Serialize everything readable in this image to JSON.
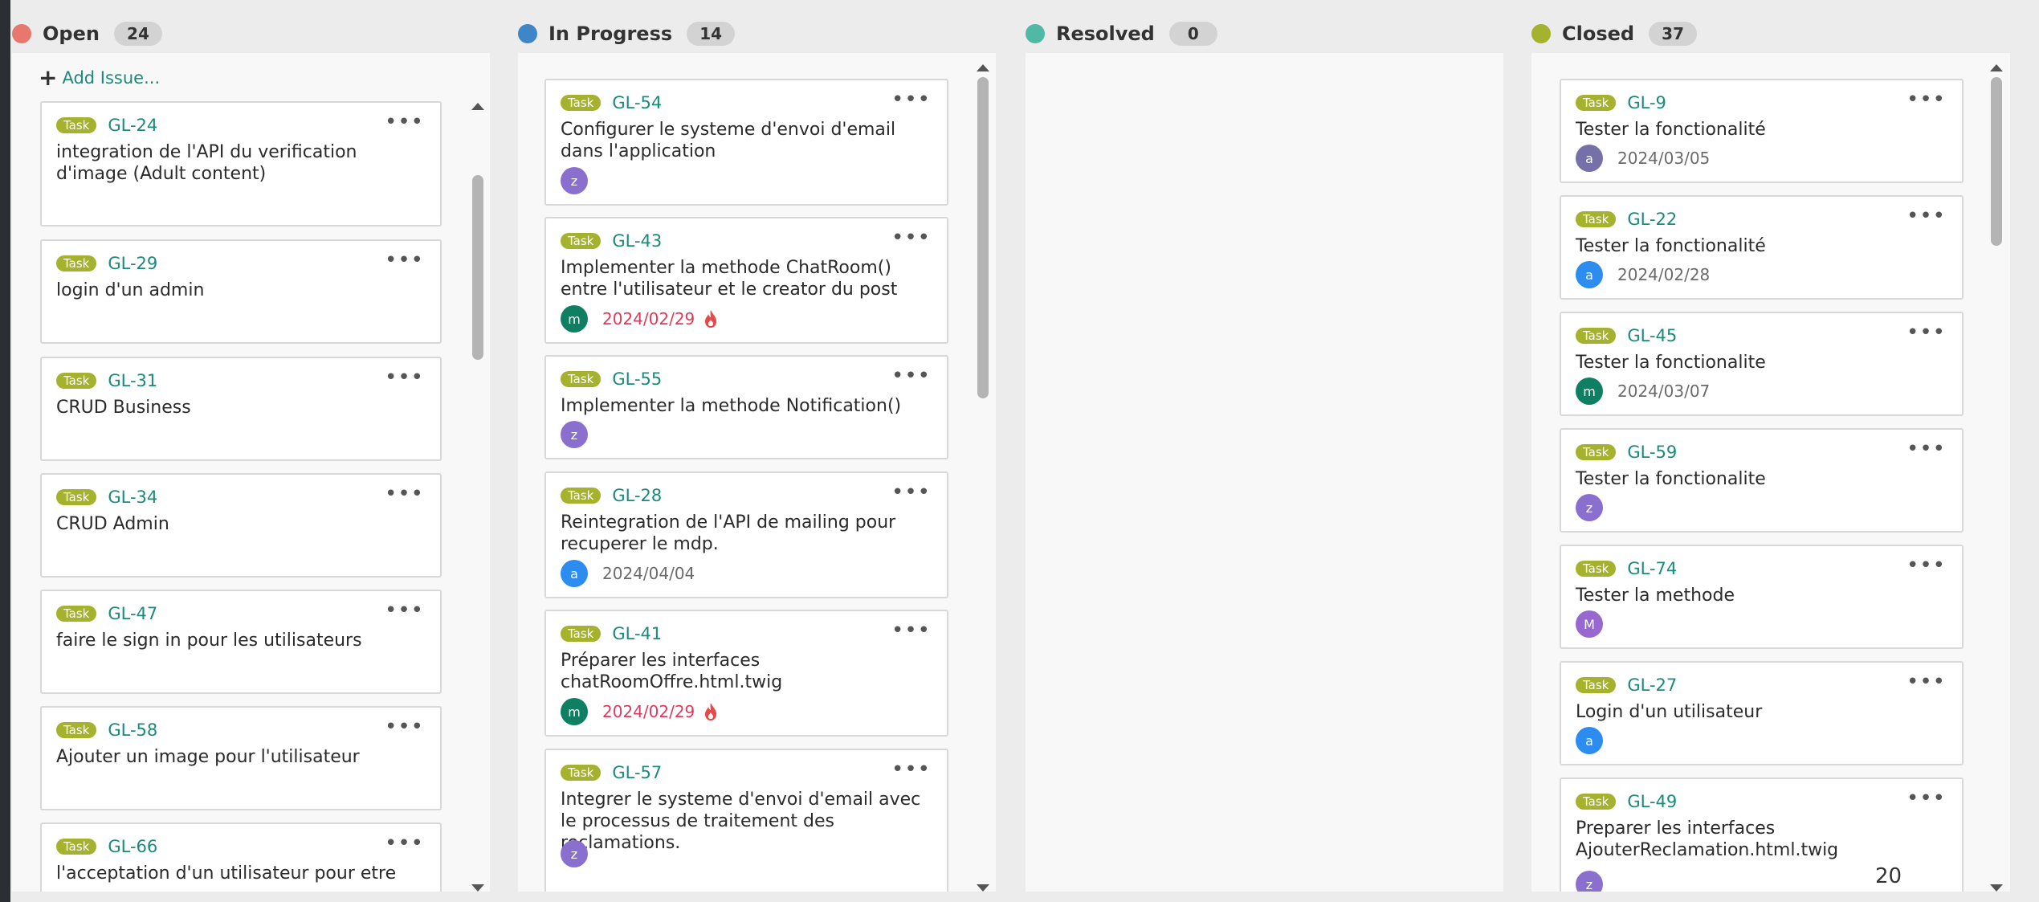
{
  "columns": {
    "open": {
      "name": "Open",
      "count": "24",
      "color": "#e8776e"
    },
    "progress": {
      "name": "In Progress",
      "count": "14",
      "color": "#3f86c9"
    },
    "resolved": {
      "name": "Resolved",
      "count": "0",
      "color": "#4fb9a6"
    },
    "closed": {
      "name": "Closed",
      "count": "37",
      "color": "#a4b22d"
    }
  },
  "add_issue_label": "Add Issue...",
  "tag_label": "Task",
  "page_number": "20",
  "colors": {
    "key": "#1a8a7b",
    "tag": "#a4b22d",
    "overdue": "#e03a5a"
  },
  "open_cards": [
    {
      "key": "GL-24",
      "title": "integration de l'API du verification d'image (Adult content)"
    },
    {
      "key": "GL-29",
      "title": "login d'un admin"
    },
    {
      "key": "GL-31",
      "title": "CRUD Business"
    },
    {
      "key": "GL-34",
      "title": "CRUD Admin"
    },
    {
      "key": "GL-47",
      "title": "faire le sign in pour les utilisateurs"
    },
    {
      "key": "GL-58",
      "title": "Ajouter un image pour l'utilisateur"
    },
    {
      "key": "GL-66",
      "title": "l'acceptation d'un utilisateur pour etre"
    }
  ],
  "progress_cards": [
    {
      "key": "GL-54",
      "title": "Configurer le systeme d'envoi d'email dans l'application",
      "avatar": "z",
      "date": ""
    },
    {
      "key": "GL-43",
      "title": "Implementer la methode ChatRoom() entre l'utilisateur et le creator du post",
      "avatar": "m",
      "date": "2024/02/29"
    },
    {
      "key": "GL-55",
      "title": "Implementer la methode Notification()",
      "avatar": "z",
      "date": ""
    },
    {
      "key": "GL-28",
      "title": "Reintegration de l'API de mailing pour recuperer le mdp.",
      "avatar": "a",
      "date": "2024/04/04"
    },
    {
      "key": "GL-41",
      "title": "Préparer les interfaces chatRoomOffre.html.twig",
      "avatar": "m",
      "date": "2024/02/29"
    },
    {
      "key": "GL-57",
      "title": "Integrer le systeme d'envoi d'email avec le processus de traitement des reclamations.",
      "avatar": "z",
      "date": ""
    }
  ],
  "closed_cards": [
    {
      "key": "GL-9",
      "title": "Tester la fonctionalité",
      "avatar": "a",
      "date": "2024/03/05"
    },
    {
      "key": "GL-22",
      "title": "Tester la fonctionalité",
      "avatar": "a",
      "date": "2024/02/28"
    },
    {
      "key": "GL-45",
      "title": "Tester la fonctionalite",
      "avatar": "m",
      "date": "2024/03/07"
    },
    {
      "key": "GL-59",
      "title": "Tester la fonctionalite",
      "avatar": "z",
      "date": ""
    },
    {
      "key": "GL-74",
      "title": "Tester la methode",
      "avatar": "M",
      "date": ""
    },
    {
      "key": "GL-27",
      "title": "Login d'un utilisateur",
      "avatar": "a",
      "date": ""
    },
    {
      "key": "GL-49",
      "title": "Preparer les interfaces AjouterReclamation.html.twig",
      "avatar": "z",
      "date": ""
    }
  ]
}
